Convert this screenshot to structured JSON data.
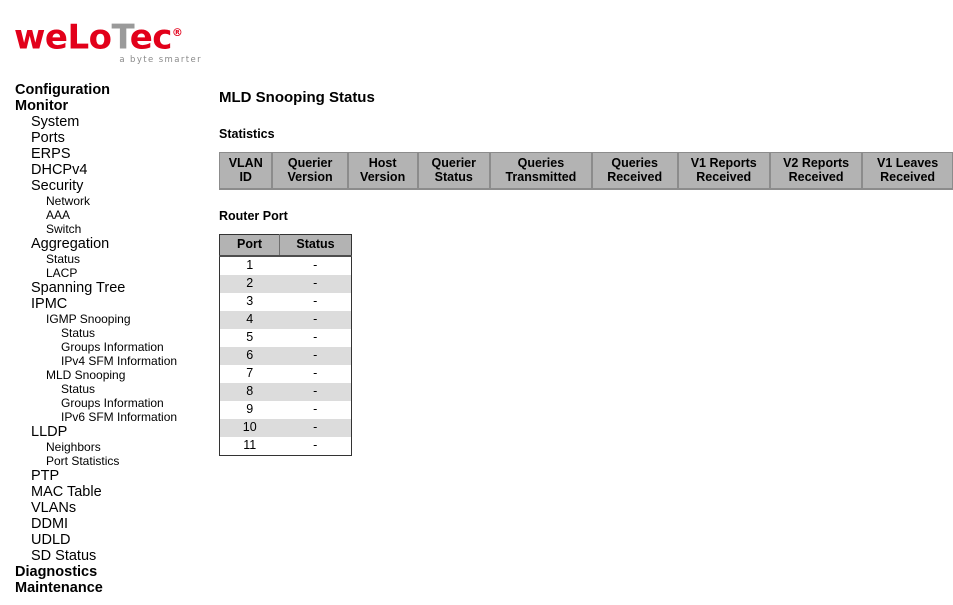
{
  "brand": {
    "name_part1": "weLo",
    "name_t": "T",
    "name_part2": "ec",
    "trademark": "®",
    "tagline": "a byte smarter",
    "red": "#e2001a",
    "gray": "#9a9a9a"
  },
  "sidebar": {
    "items": [
      {
        "label": "Configuration",
        "level": 1
      },
      {
        "label": "Monitor",
        "level": 1
      },
      {
        "label": "System",
        "level": 2
      },
      {
        "label": "Ports",
        "level": 2
      },
      {
        "label": "ERPS",
        "level": 2
      },
      {
        "label": "DHCPv4",
        "level": 2
      },
      {
        "label": "Security",
        "level": 2
      },
      {
        "label": "Network",
        "level": 3
      },
      {
        "label": "AAA",
        "level": 3
      },
      {
        "label": "Switch",
        "level": 3
      },
      {
        "label": "Aggregation",
        "level": 2
      },
      {
        "label": "Status",
        "level": 3
      },
      {
        "label": "LACP",
        "level": 3
      },
      {
        "label": "Spanning Tree",
        "level": 2
      },
      {
        "label": "IPMC",
        "level": 2
      },
      {
        "label": "IGMP Snooping",
        "level": 3
      },
      {
        "label": "Status",
        "level": 4
      },
      {
        "label": "Groups Information",
        "level": 4
      },
      {
        "label": "IPv4 SFM Information",
        "level": 4
      },
      {
        "label": "MLD Snooping",
        "level": 3
      },
      {
        "label": "Status",
        "level": 4
      },
      {
        "label": "Groups Information",
        "level": 4
      },
      {
        "label": "IPv6 SFM Information",
        "level": 4
      },
      {
        "label": "LLDP",
        "level": 2
      },
      {
        "label": "Neighbors",
        "level": 3
      },
      {
        "label": "Port Statistics",
        "level": 3
      },
      {
        "label": "PTP",
        "level": 2
      },
      {
        "label": "MAC Table",
        "level": 2
      },
      {
        "label": "VLANs",
        "level": 2
      },
      {
        "label": "DDMI",
        "level": 2
      },
      {
        "label": "UDLD",
        "level": 2
      },
      {
        "label": "SD Status",
        "level": 2
      },
      {
        "label": "Diagnostics",
        "level": 1
      },
      {
        "label": "Maintenance",
        "level": 1
      }
    ]
  },
  "main": {
    "page_title": "MLD Snooping Status",
    "statistics": {
      "section_title": "Statistics",
      "columns": [
        "VLAN ID",
        "Querier Version",
        "Host Version",
        "Querier Status",
        "Queries Transmitted",
        "Queries Received",
        "V1 Reports Received",
        "V2 Reports Received",
        "V1 Leaves Received"
      ],
      "rows": []
    },
    "router_port": {
      "section_title": "Router Port",
      "columns": [
        "Port",
        "Status"
      ],
      "rows": [
        {
          "port": "1",
          "status": "-"
        },
        {
          "port": "2",
          "status": "-"
        },
        {
          "port": "3",
          "status": "-"
        },
        {
          "port": "4",
          "status": "-"
        },
        {
          "port": "5",
          "status": "-"
        },
        {
          "port": "6",
          "status": "-"
        },
        {
          "port": "7",
          "status": "-"
        },
        {
          "port": "8",
          "status": "-"
        },
        {
          "port": "9",
          "status": "-"
        },
        {
          "port": "10",
          "status": "-"
        },
        {
          "port": "11",
          "status": "-"
        }
      ]
    }
  }
}
